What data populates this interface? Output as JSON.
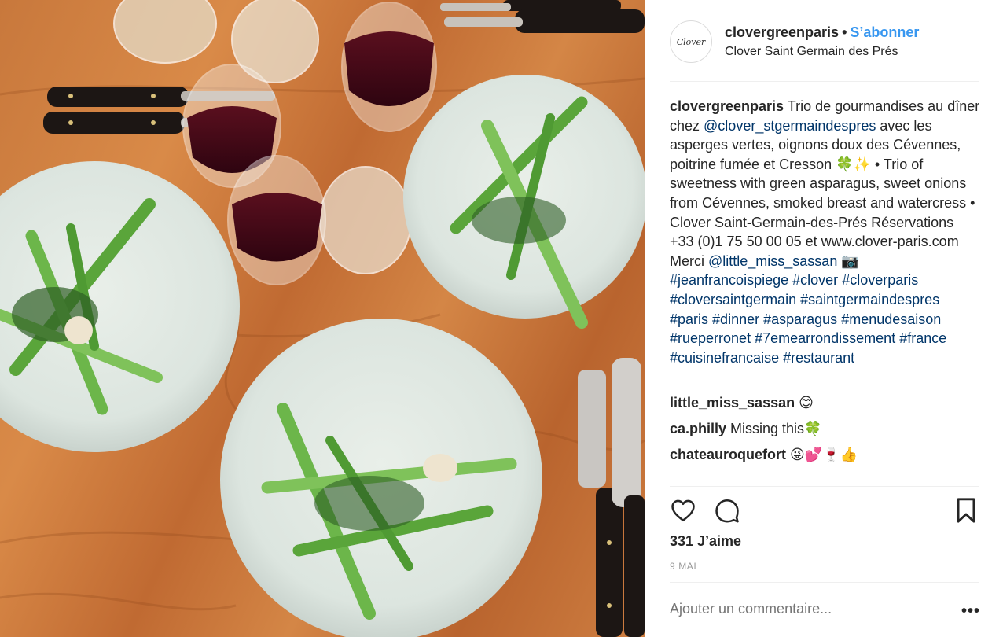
{
  "post": {
    "username": "clovergreenparis",
    "dot": "•",
    "follow_label": "S’abonner",
    "location": "Clover Saint Germain des Prés",
    "avatar_text": "Clover",
    "photo_alt": "Three plates of green asparagus on a wooden table with red wine glasses"
  },
  "caption": {
    "username": "clovergreenparis",
    "seg1": " Trio de gourmandises au dîner chez ",
    "mention1": "@clover_stgermaindespres",
    "seg2": " avec les asperges vertes, oignons doux des Cévennes, poitrine fumée et Cresson 🍀✨ • Trio of sweetness with green asparagus, sweet onions from Cévennes, smoked breast and watercress • Clover Saint-Germain-des-Prés Réservations +33 (0)1 75 50 00 05 et www.clover-paris.com Merci ",
    "mention2": "@little_miss_sassan",
    "seg3": " 📷 ",
    "hashtags": [
      "#jeanfrancoispiege",
      "#clover",
      "#cloverparis",
      "#cloversaintgermain",
      "#saintgermaindespres",
      "#paris",
      "#dinner",
      "#asparagus",
      "#menudesaison",
      "#rueperronet",
      "#7emearrondissement",
      "#france",
      "#cuisinefrancaise",
      "#restaurant"
    ]
  },
  "comments": [
    {
      "user": "little_miss_sassan",
      "text": " 😊"
    },
    {
      "user": "ca.philly",
      "text": " Missing this🍀"
    },
    {
      "user": "chateauroquefort",
      "text": " 😜💕🍷👍"
    }
  ],
  "actions": {
    "like_icon": "heart-icon",
    "comment_icon": "comment-bubble-icon",
    "save_icon": "bookmark-icon"
  },
  "likes_text": "331 J’aime",
  "date_text": "9 MAI",
  "add_comment_placeholder": "Ajouter un commentaire...",
  "more_label": "•••",
  "colors": {
    "link_blue": "#3897f0",
    "mention_blue": "#003569",
    "text": "#262626",
    "muted": "#999999",
    "divider": "#efefef"
  }
}
